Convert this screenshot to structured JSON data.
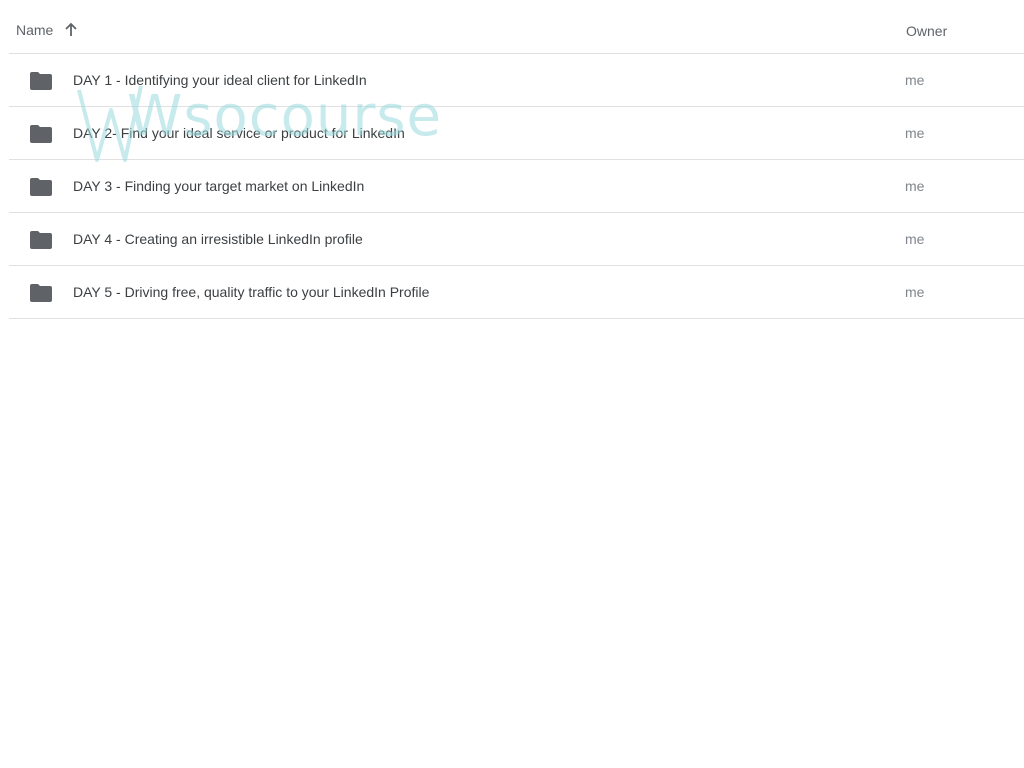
{
  "header": {
    "name_label": "Name",
    "owner_label": "Owner",
    "sort_icon": "arrow-up-icon"
  },
  "rows": [
    {
      "name": "DAY 1 - Identifying your ideal client for LinkedIn",
      "owner": "me",
      "icon": "folder-icon"
    },
    {
      "name": "DAY 2- Find your ideal service or product for LinkedIn",
      "owner": "me",
      "icon": "folder-icon"
    },
    {
      "name": "DAY 3 - Finding your target market on LinkedIn",
      "owner": "me",
      "icon": "folder-icon"
    },
    {
      "name": "DAY 4 - Creating an irresistible LinkedIn profile",
      "owner": "me",
      "icon": "folder-icon"
    },
    {
      "name": "DAY 5 - Driving free, quality traffic to your LinkedIn Profile",
      "owner": "me",
      "icon": "folder-icon"
    }
  ],
  "watermark": {
    "text": "Wsocourse"
  },
  "colors": {
    "folder": "#5f6368",
    "divider": "#e0e0e0",
    "watermark": "#9bd9dd"
  }
}
